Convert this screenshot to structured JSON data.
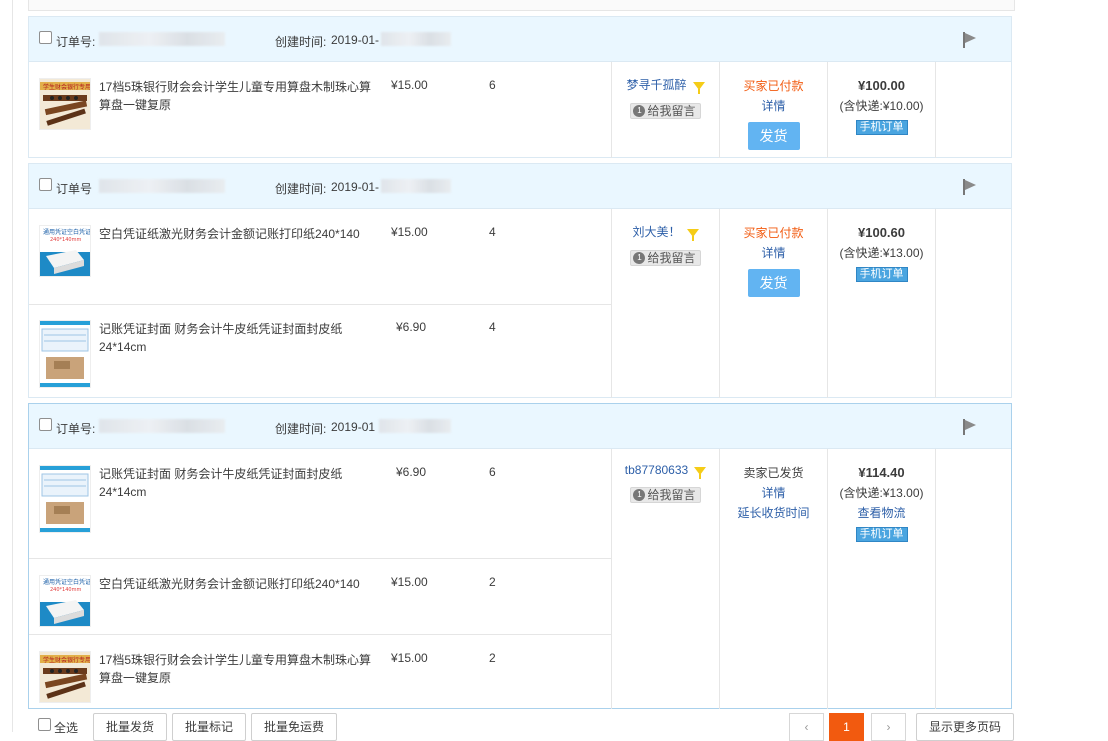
{
  "orders": [
    {
      "orderno_label": "订单号:",
      "created_label": "创建时间:",
      "created_value": "2019-01-",
      "items": [
        {
          "title": "17档5珠银行财会会计学生儿童专用算盘木制珠心算算盘一键复原",
          "price": "¥15.00",
          "qty": "6",
          "thumb_icon": "abacus-thumb-icon"
        }
      ],
      "buyer": "梦寻千孤醉",
      "msg_label": "给我留言",
      "status": "买家已付款",
      "detail": "详情",
      "ship": "发货",
      "total": "¥100.00",
      "shipping_note": "(含快递:¥10.00)",
      "badge": "手机订单"
    },
    {
      "orderno_label": "订单号",
      "created_label": "创建时间:",
      "created_value": "2019-01-",
      "items": [
        {
          "title": "空白凭证纸激光财务会计金额记账打印纸240*140",
          "price": "¥15.00",
          "qty": "4",
          "thumb_icon": "voucher-paper-thumb-icon"
        },
        {
          "title": "记账凭证封面 财务会计牛皮纸凭证封面封皮纸24*14cm",
          "price": "¥6.90",
          "qty": "4",
          "thumb_icon": "voucher-cover-thumb-icon"
        }
      ],
      "buyer": "刘大美！",
      "msg_label": "给我留言",
      "status": "买家已付款",
      "detail": "详情",
      "ship": "发货",
      "total": "¥100.60",
      "shipping_note": "(含快递:¥13.00)",
      "badge": "手机订单"
    },
    {
      "orderno_label": "订单号:",
      "created_label": "创建时间:",
      "created_value": "2019-01",
      "items": [
        {
          "title": "记账凭证封面 财务会计牛皮纸凭证封面封皮纸24*14cm",
          "price": "¥6.90",
          "qty": "6",
          "thumb_icon": "voucher-cover-thumb-icon"
        },
        {
          "title": "空白凭证纸激光财务会计金额记账打印纸240*140",
          "price": "¥15.00",
          "qty": "2",
          "thumb_icon": "voucher-paper-thumb-icon"
        },
        {
          "title": "17档5珠银行财会会计学生儿童专用算盘木制珠心算算盘一键复原",
          "price": "¥15.00",
          "qty": "2",
          "thumb_icon": "abacus-thumb-icon"
        }
      ],
      "buyer": "tb87780633",
      "msg_label": "给我留言",
      "status": "卖家已发货",
      "detail": "详情",
      "extend": "延长收货时间",
      "total": "¥114.40",
      "shipping_note": "(含快递:¥13.00)",
      "logistics": "查看物流",
      "badge": "手机订单"
    }
  ],
  "footer": {
    "select_all": "全选",
    "batch_ship": "批量发货",
    "batch_mark": "批量标记",
    "batch_free_ship": "批量免运费",
    "prev": "‹",
    "current_page": "1",
    "next": "›",
    "more": "显示更多页码"
  }
}
